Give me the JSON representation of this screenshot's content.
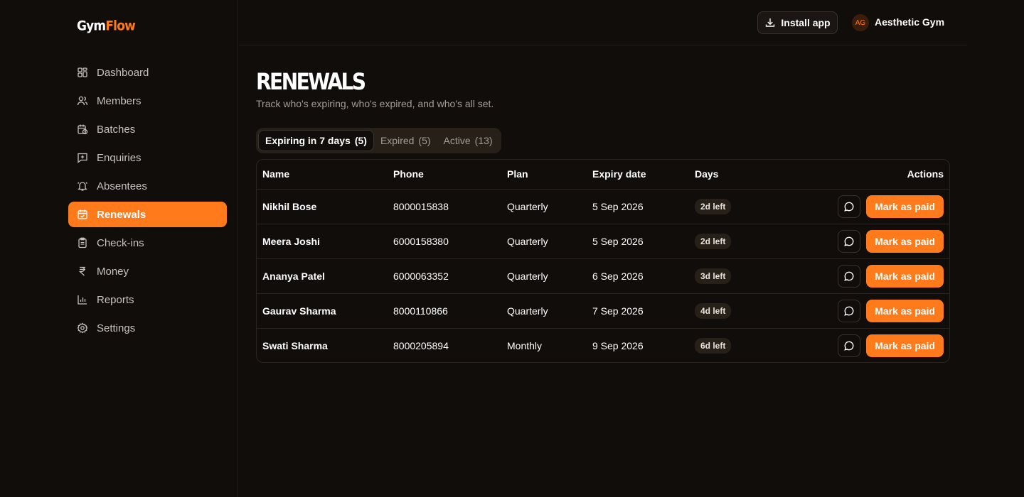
{
  "brand": {
    "part1": "Gym",
    "part2": "Flow",
    "accent_color": "#ff7a1a"
  },
  "sidebar": {
    "items": [
      {
        "label": "Dashboard",
        "icon": "dashboard-icon"
      },
      {
        "label": "Members",
        "icon": "users-icon"
      },
      {
        "label": "Batches",
        "icon": "calendar-clock-icon"
      },
      {
        "label": "Enquiries",
        "icon": "message-plus-icon"
      },
      {
        "label": "Absentees",
        "icon": "bell-icon"
      },
      {
        "label": "Renewals",
        "icon": "calendar-check-icon",
        "active": true
      },
      {
        "label": "Check-ins",
        "icon": "clipboard-icon"
      },
      {
        "label": "Money",
        "icon": "rupee-icon"
      },
      {
        "label": "Reports",
        "icon": "bar-chart-icon"
      },
      {
        "label": "Settings",
        "icon": "gear-icon"
      }
    ]
  },
  "header": {
    "install_label": "Install app",
    "avatar_initials": "AG",
    "gym_name": "Aesthetic Gym"
  },
  "page": {
    "title": "RENEWALS",
    "subtitle": "Track who's expiring, who's expired, and who's all set."
  },
  "tabs": [
    {
      "label": "Expiring in 7 days",
      "count": "(5)",
      "active": true
    },
    {
      "label": "Expired",
      "count": "(5)"
    },
    {
      "label": "Active",
      "count": "(13)"
    }
  ],
  "table": {
    "headers": {
      "name": "Name",
      "phone": "Phone",
      "plan": "Plan",
      "expiry": "Expiry date",
      "days": "Days",
      "actions": "Actions"
    },
    "action_label": "Mark as paid",
    "rows": [
      {
        "name": "Nikhil Bose",
        "phone": "8000015838",
        "plan": "Quarterly",
        "expiry": "5 Sep 2026",
        "days": "2d left"
      },
      {
        "name": "Meera Joshi",
        "phone": "6000158380",
        "plan": "Quarterly",
        "expiry": "5 Sep 2026",
        "days": "2d left"
      },
      {
        "name": "Ananya Patel",
        "phone": "6000063352",
        "plan": "Quarterly",
        "expiry": "6 Sep 2026",
        "days": "3d left"
      },
      {
        "name": "Gaurav Sharma",
        "phone": "8000110866",
        "plan": "Quarterly",
        "expiry": "7 Sep 2026",
        "days": "4d left"
      },
      {
        "name": "Swati Sharma",
        "phone": "8000205894",
        "plan": "Monthly",
        "expiry": "9 Sep 2026",
        "days": "6d left"
      }
    ]
  }
}
